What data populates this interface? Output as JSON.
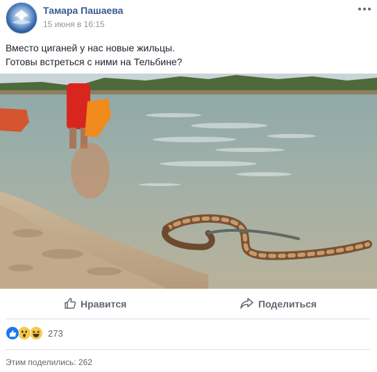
{
  "post": {
    "author": "Тамара Пашаева",
    "timestamp": "15 июня в 16:15",
    "text_line1": "Вместо циганей у нас новые жильцы.",
    "text_line2": "Готовы встреться с ними на Тельбине?"
  },
  "actions": {
    "like_label": "Нравится",
    "share_label": "Поделиться"
  },
  "reactions": {
    "count": "273",
    "types": [
      "like-icon",
      "wow-icon",
      "haha-icon"
    ]
  },
  "shares": {
    "text": "Этим поделились: 262"
  },
  "colors": {
    "link": "#385898",
    "secondary_text": "#90949c",
    "action_text": "#606770",
    "like_blue": "#1877f2",
    "emoji_yellow": "#f7c948"
  },
  "icons": {
    "options": "more-options-icon",
    "like": "thumbs-up-icon",
    "share": "share-arrow-icon"
  }
}
